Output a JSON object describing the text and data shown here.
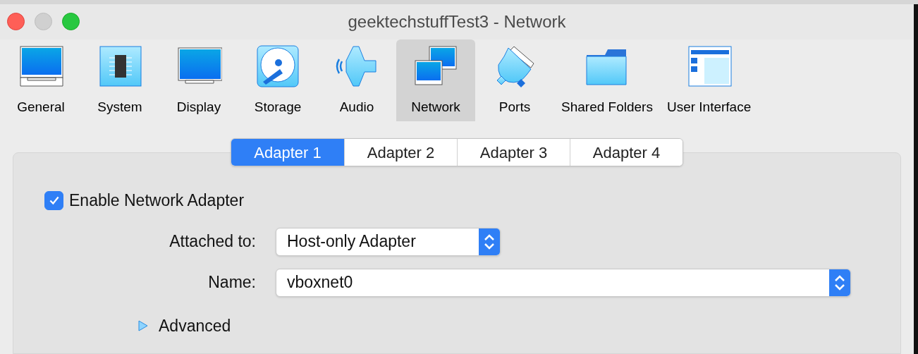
{
  "window": {
    "title": "geektechstuffTest3 - Network"
  },
  "toolbar": [
    {
      "label": "General",
      "selected": false
    },
    {
      "label": "System",
      "selected": false
    },
    {
      "label": "Display",
      "selected": false
    },
    {
      "label": "Storage",
      "selected": false
    },
    {
      "label": "Audio",
      "selected": false
    },
    {
      "label": "Network",
      "selected": true
    },
    {
      "label": "Ports",
      "selected": false
    },
    {
      "label": "Shared Folders",
      "selected": false
    },
    {
      "label": "User Interface",
      "selected": false
    }
  ],
  "tabs": [
    {
      "label": "Adapter 1",
      "selected": true
    },
    {
      "label": "Adapter 2",
      "selected": false
    },
    {
      "label": "Adapter 3",
      "selected": false
    },
    {
      "label": "Adapter 4",
      "selected": false
    }
  ],
  "enable_adapter": {
    "label": "Enable Network Adapter",
    "checked": true
  },
  "fields": [
    {
      "label": "Attached to:",
      "value": "Host-only Adapter",
      "kind": "short"
    },
    {
      "label": "Name:",
      "value": "vboxnet0",
      "kind": "wide"
    }
  ],
  "advanced": {
    "label": "Advanced",
    "expanded": false
  }
}
